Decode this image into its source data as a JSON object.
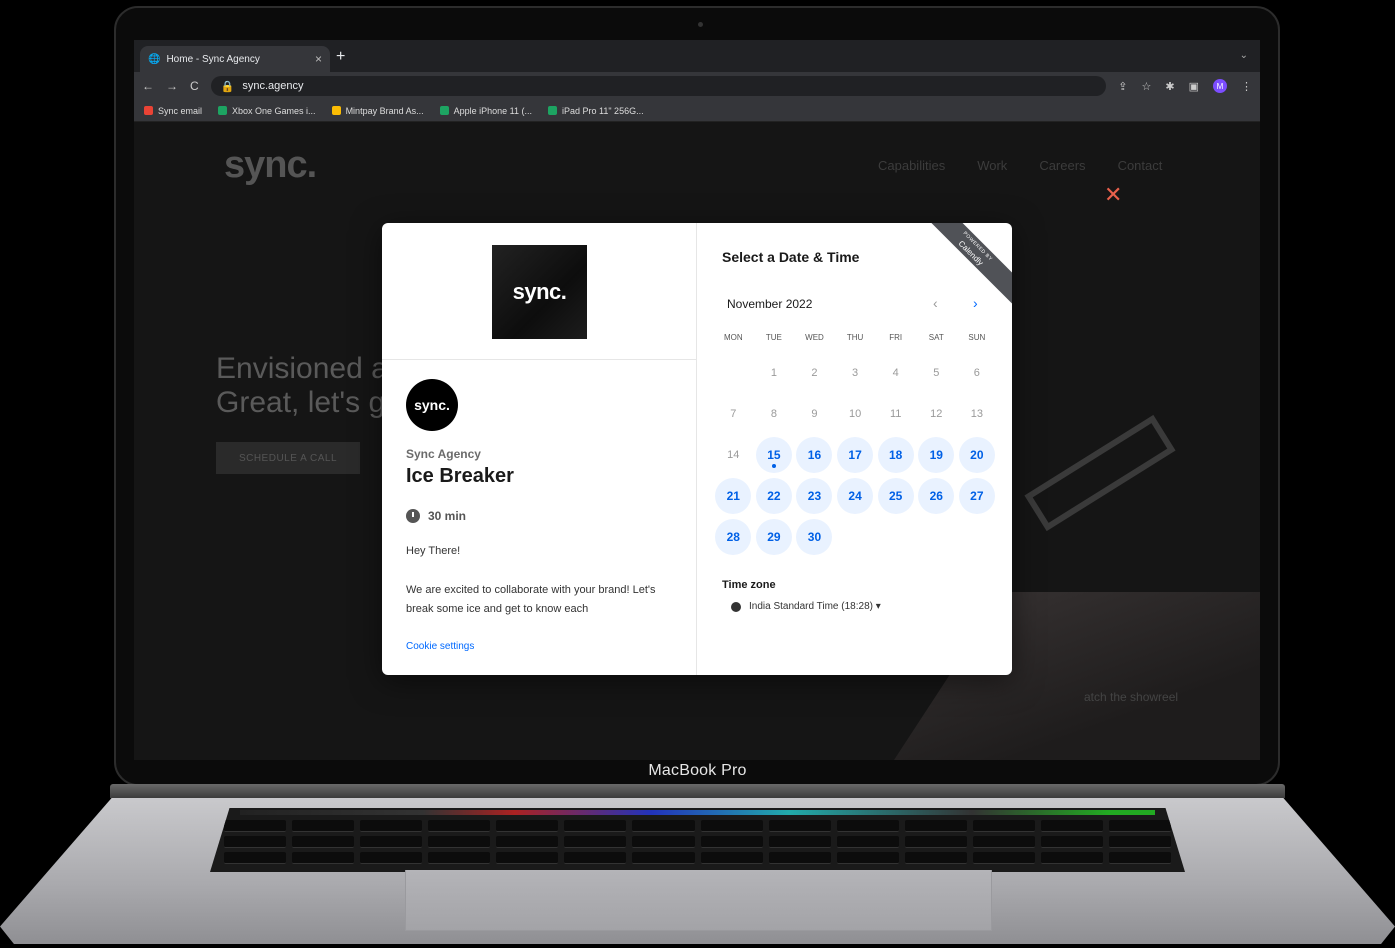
{
  "browser": {
    "tab_title": "Home - Sync Agency",
    "tab_close": "×",
    "new_tab": "+",
    "tab_menu": "⌄",
    "url": "sync.agency",
    "profile_initial": "M",
    "bookmarks": [
      {
        "label": "Sync email",
        "color": "#ea4335"
      },
      {
        "label": "Xbox One Games i...",
        "color": "#1da462"
      },
      {
        "label": "Mintpay Brand As...",
        "color": "#fbbc04"
      },
      {
        "label": "Apple iPhone 11 (...",
        "color": "#1da462"
      },
      {
        "label": "iPad Pro 11\" 256G...",
        "color": "#1da462"
      }
    ]
  },
  "site": {
    "logo": "sync.",
    "nav": [
      "Capabilities",
      "Work",
      "Careers",
      "Contact"
    ],
    "close": "✕",
    "hero_line1": "Envisioned a",
    "hero_line2": "Great, let's g",
    "cta": "SCHEDULE A CALL",
    "showreel": "atch the showreel"
  },
  "modal": {
    "badge_small": "POWERED BY",
    "badge": "Calendly",
    "brand_logo": "sync.",
    "org_name": "Sync Agency",
    "event_title": "Ice Breaker",
    "duration": "30 min",
    "greeting": "Hey There!",
    "description": "We are excited to collaborate with your brand! Let's break some ice and get to know each",
    "cookie": "Cookie settings",
    "select_title": "Select a Date & Time",
    "month": "November 2022",
    "prev": "‹",
    "next": "›",
    "weekdays": [
      "MON",
      "TUE",
      "WED",
      "THU",
      "FRI",
      "SAT",
      "SUN"
    ],
    "days": [
      {
        "d": "",
        "a": false
      },
      {
        "d": "1",
        "a": false
      },
      {
        "d": "2",
        "a": false
      },
      {
        "d": "3",
        "a": false
      },
      {
        "d": "4",
        "a": false
      },
      {
        "d": "5",
        "a": false
      },
      {
        "d": "6",
        "a": false
      },
      {
        "d": "7",
        "a": false
      },
      {
        "d": "8",
        "a": false
      },
      {
        "d": "9",
        "a": false
      },
      {
        "d": "10",
        "a": false
      },
      {
        "d": "11",
        "a": false
      },
      {
        "d": "12",
        "a": false
      },
      {
        "d": "13",
        "a": false
      },
      {
        "d": "14",
        "a": false
      },
      {
        "d": "15",
        "a": true,
        "today": true
      },
      {
        "d": "16",
        "a": true
      },
      {
        "d": "17",
        "a": true
      },
      {
        "d": "18",
        "a": true
      },
      {
        "d": "19",
        "a": true
      },
      {
        "d": "20",
        "a": true
      },
      {
        "d": "21",
        "a": true
      },
      {
        "d": "22",
        "a": true
      },
      {
        "d": "23",
        "a": true
      },
      {
        "d": "24",
        "a": true
      },
      {
        "d": "25",
        "a": true
      },
      {
        "d": "26",
        "a": true
      },
      {
        "d": "27",
        "a": true
      },
      {
        "d": "28",
        "a": true
      },
      {
        "d": "29",
        "a": true
      },
      {
        "d": "30",
        "a": true
      }
    ],
    "tz_label": "Time zone",
    "tz_value": "India Standard Time (18:28) ▾"
  },
  "device": {
    "label": "MacBook Pro"
  }
}
